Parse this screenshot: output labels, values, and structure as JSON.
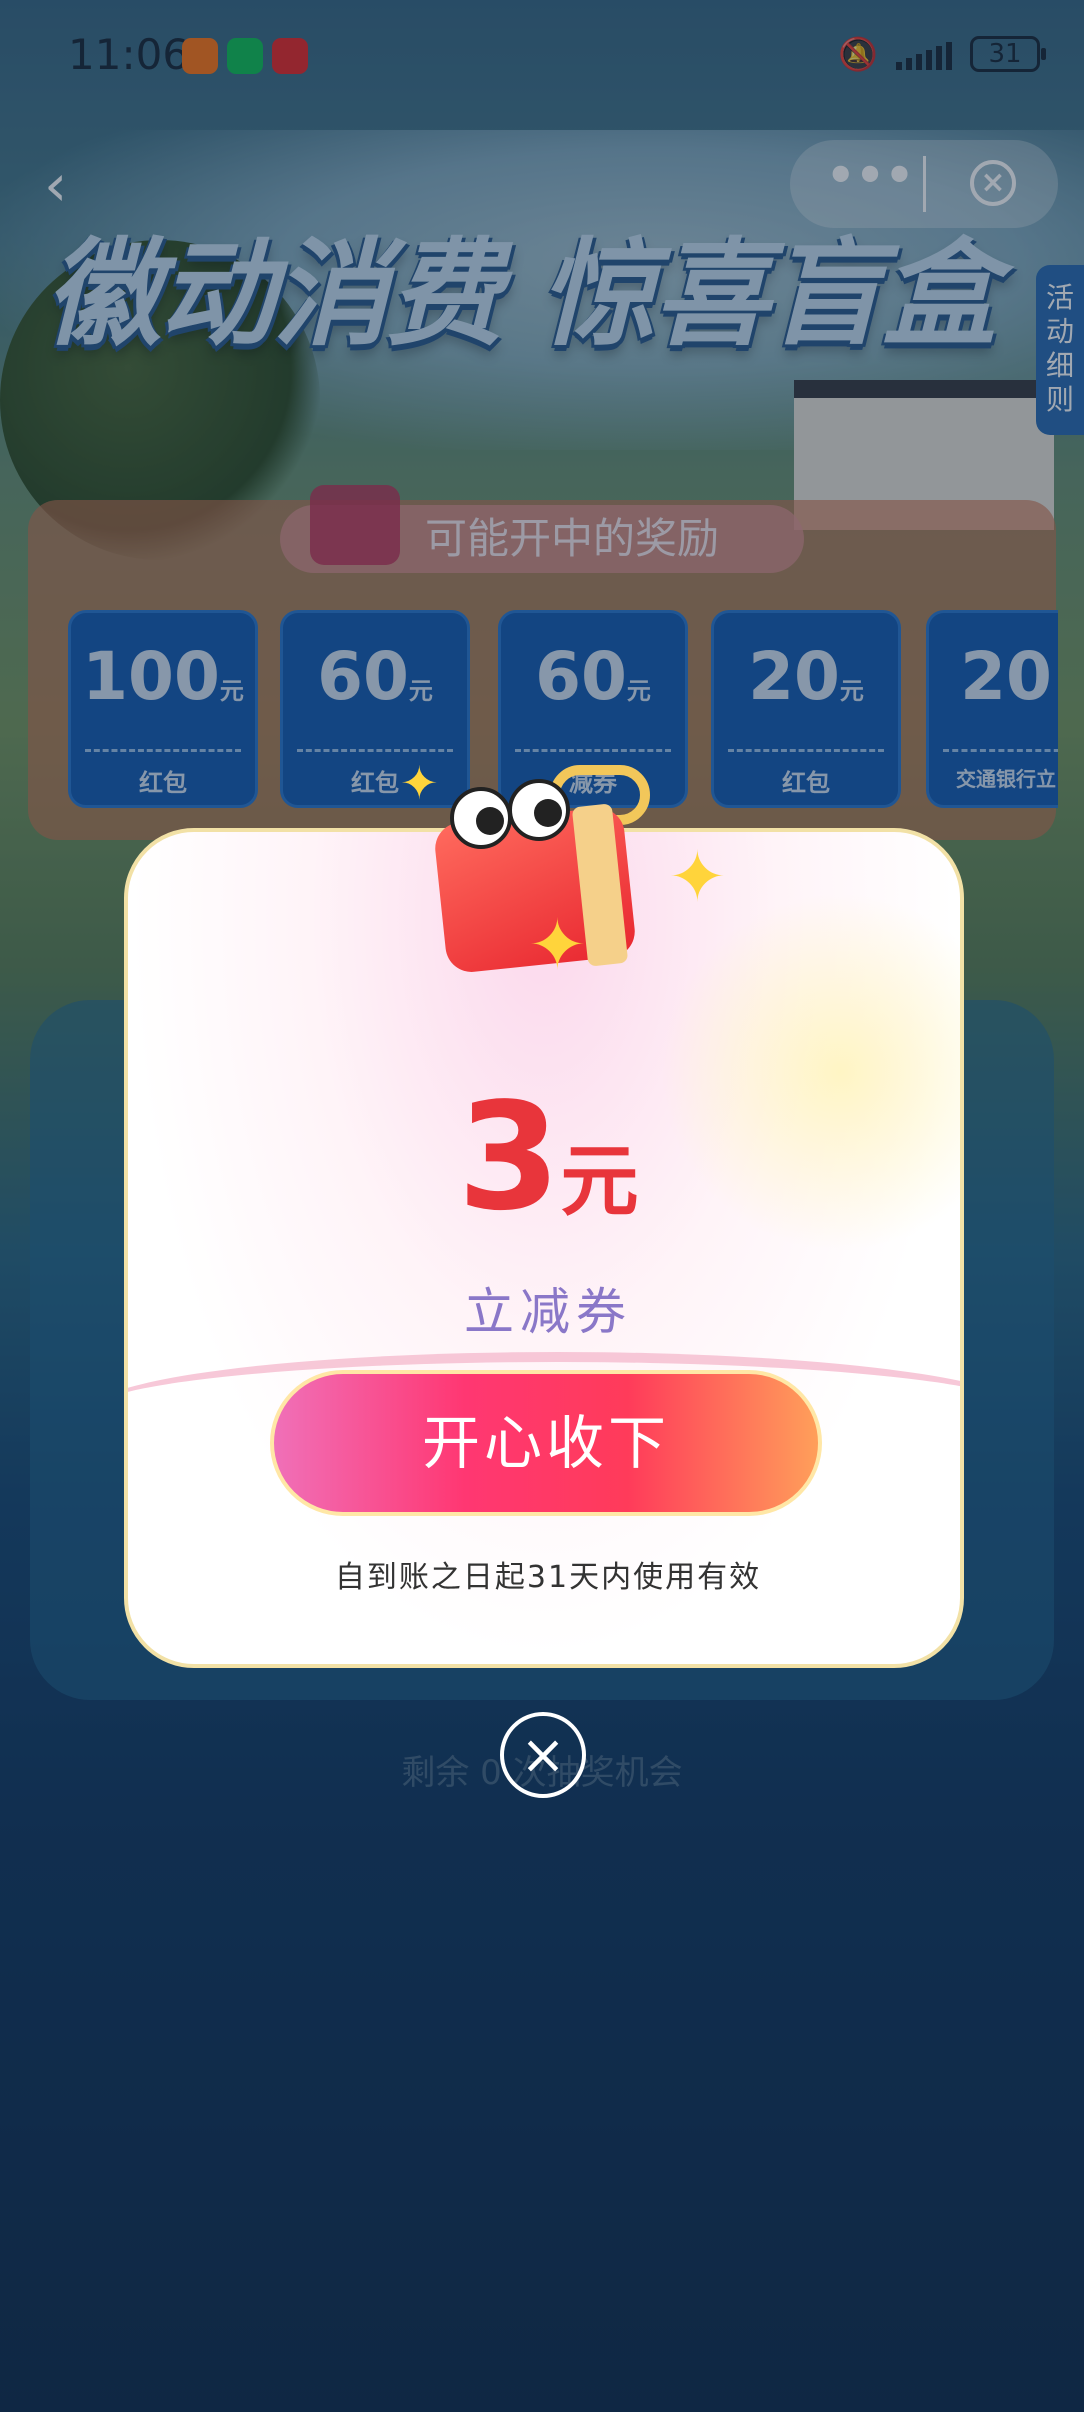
{
  "status_bar": {
    "time": "11:06",
    "battery": "31",
    "icons": [
      "taobao-icon",
      "wechat-icon",
      "bank-app-icon",
      "mute-bell-icon",
      "signal-icon",
      "battery-icon"
    ]
  },
  "nav": {
    "back_icon": "‹",
    "more_icon": "•••",
    "close_icon": "×"
  },
  "banner": {
    "title": "徽动消费 惊喜盲盒",
    "rules_tab": [
      "活",
      "动",
      "细",
      "则"
    ]
  },
  "prize_section": {
    "header": "可能开中的奖励",
    "prizes": [
      {
        "amount": "100",
        "unit": "元",
        "label": "红包"
      },
      {
        "amount": "60",
        "unit": "元",
        "label": "红包"
      },
      {
        "amount": "60",
        "unit": "元",
        "label": "减券"
      },
      {
        "amount": "20",
        "unit": "元",
        "label": "红包"
      },
      {
        "amount": "20",
        "unit": "",
        "label": "交通银行立"
      }
    ]
  },
  "remaining": "剩余 0 次抽奖机会",
  "popup": {
    "amount": "3",
    "unit": "元",
    "coupon_type": "立减券",
    "accept_button": "开心收下",
    "validity": "自到账之日起31天内使用有效",
    "close_icon": "×"
  },
  "colors": {
    "accent_red": "#e8353b",
    "button_pink": "#ff3772",
    "coupon_purple": "#8a77c8",
    "prize_blue": "#1a5fb3"
  }
}
